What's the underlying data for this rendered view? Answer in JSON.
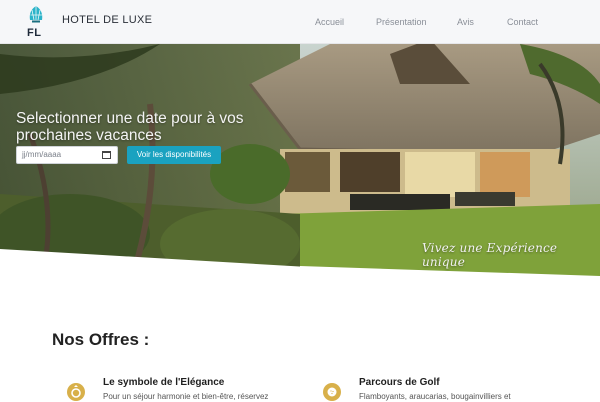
{
  "header": {
    "logo_text": "FL",
    "brand": "HOTEL DE LUXE",
    "nav": [
      {
        "label": "Accueil"
      },
      {
        "label": "Présentation"
      },
      {
        "label": "Avis"
      },
      {
        "label": "Contact"
      }
    ]
  },
  "hero": {
    "title": "Selectionner une date pour à vos prochaines vacances",
    "date_placeholder": "jj/mm/aaaa",
    "button_label": "Voir les disponibilités",
    "slogan": "Vivez une Expérience unique"
  },
  "offers": {
    "title": "Nos Offres :",
    "items": [
      {
        "title": "Le symbole de l'Elégance",
        "text": "Pour un séjour harmonie et bien-être, réservez",
        "icon": "ring-icon",
        "color": "#d8b04a"
      },
      {
        "title": "Parcours de Golf",
        "text": "Flamboyants, araucarias, bougainvilliers et",
        "icon": "golf-icon",
        "color": "#d8b04a"
      }
    ]
  },
  "colors": {
    "accent": "#1aa2c0",
    "gold": "#d8b04a",
    "header_bg": "#f6f7f9"
  }
}
